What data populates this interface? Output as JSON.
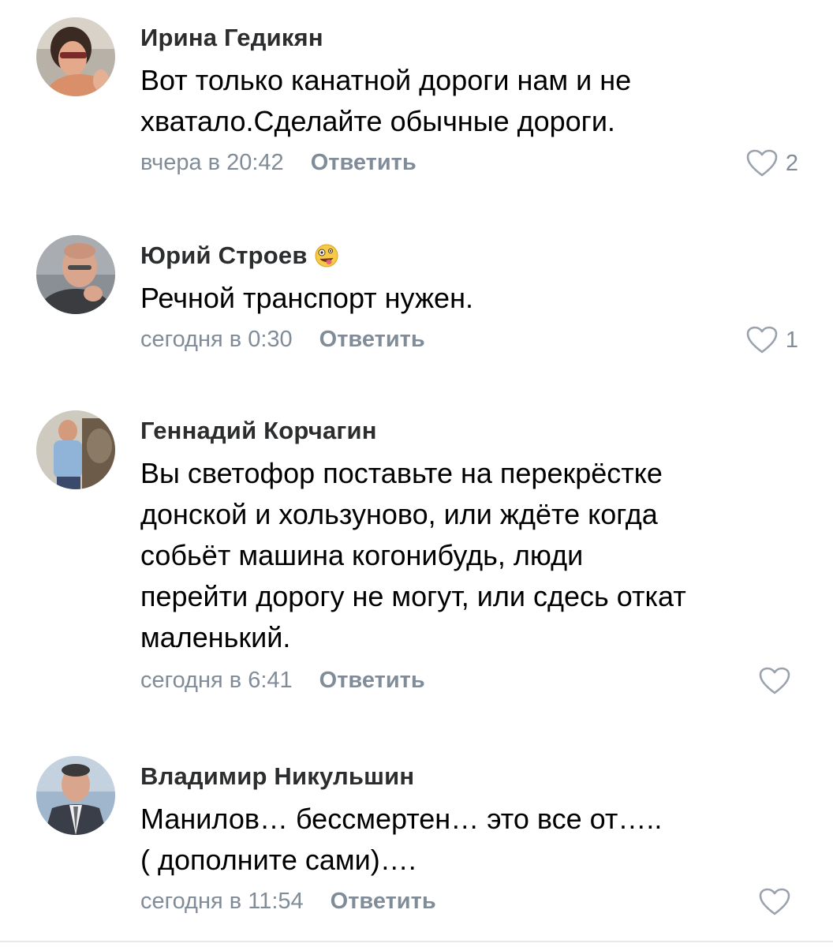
{
  "colors": {
    "secondary_text": "#818c99",
    "author_text": "#2c2d2e",
    "body_text": "#000000",
    "like_icon": "#99a2ad"
  },
  "comments": [
    {
      "author": "Ирина Гедикян",
      "text_lines": [
        "Вот только канатной дороги нам и не",
        "хватало.Сделайте обычные дороги."
      ],
      "time": "вчера в 20:42",
      "reply_label": "Ответить",
      "likes": "2",
      "avatar_icon": "avatar-photo"
    },
    {
      "author": "Юрий Строев",
      "author_emoji": "zany-face-emoji",
      "text_lines": [
        "Речной транспорт нужен."
      ],
      "time": "сегодня в 0:30",
      "reply_label": "Ответить",
      "likes": "1",
      "avatar_icon": "avatar-photo"
    },
    {
      "author": "Геннадий Корчагин",
      "text_lines": [
        "Вы светофор поставьте на перекрёстке",
        "донской и хользуново, или ждёте когда",
        "собьёт машина когонибудь, люди",
        "перейти дорогу не могут, или сдесь откат",
        "маленький."
      ],
      "time": "сегодня в 6:41",
      "reply_label": "Ответить",
      "likes": "",
      "avatar_icon": "avatar-photo"
    },
    {
      "author": "Владимир Никульшин",
      "text_lines": [
        "Манилов… бессмертен… это все от…..",
        "( дополните сами)…."
      ],
      "time": "сегодня в 11:54",
      "reply_label": "Ответить",
      "likes": "",
      "avatar_icon": "avatar-photo"
    }
  ]
}
